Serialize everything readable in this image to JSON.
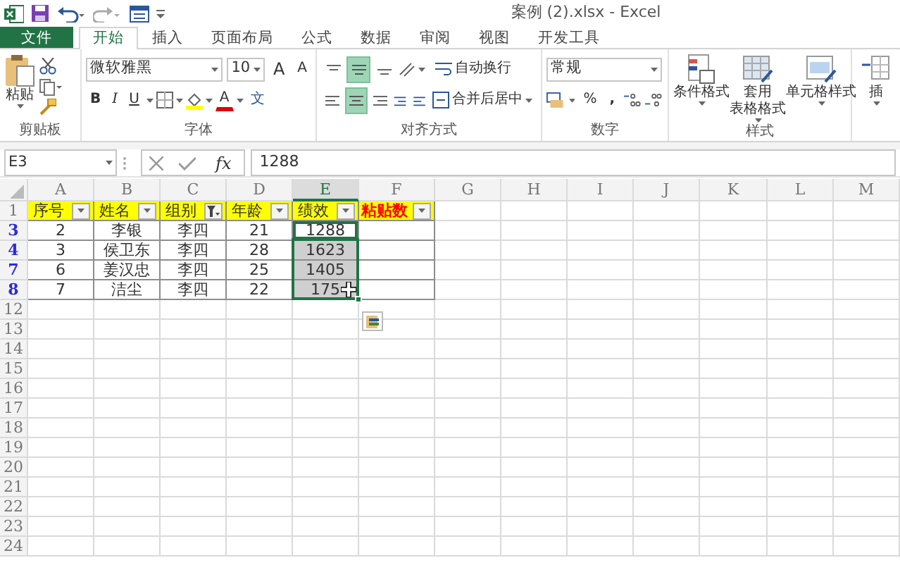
{
  "window": {
    "title": "案例 (2).xlsx - Excel"
  },
  "ribbon_tabs": [
    {
      "label": "文件",
      "kind": "file",
      "selected": false
    },
    {
      "label": "开始",
      "kind": "tab",
      "selected": true
    },
    {
      "label": "插入",
      "kind": "tab",
      "selected": false
    },
    {
      "label": "页面布局",
      "kind": "tab",
      "selected": false
    },
    {
      "label": "公式",
      "kind": "tab",
      "selected": false
    },
    {
      "label": "数据",
      "kind": "tab",
      "selected": false
    },
    {
      "label": "审阅",
      "kind": "tab",
      "selected": false
    },
    {
      "label": "视图",
      "kind": "tab",
      "selected": false
    },
    {
      "label": "开发工具",
      "kind": "tab",
      "selected": false
    }
  ],
  "ribbon": {
    "clipboard": {
      "label": "剪贴板",
      "paste": "粘贴"
    },
    "font": {
      "label": "字体",
      "font_name": "微软雅黑",
      "font_size": "10",
      "grow": "A",
      "shrink": "A",
      "bold": "B",
      "italic": "I",
      "underline": "U",
      "font_color": "A",
      "phonetic": "文"
    },
    "alignment": {
      "label": "对齐方式",
      "vertical": [
        {
          "selected": false
        },
        {
          "selected": true
        },
        {
          "selected": false
        }
      ],
      "horizontal": [
        {
          "selected": false
        },
        {
          "selected": true
        },
        {
          "selected": false
        }
      ],
      "wrap_text": "自动换行",
      "merge_center": "合并后居中"
    },
    "number": {
      "label": "数字",
      "format": "常规",
      "percent": "%",
      "comma": ","
    },
    "styles": {
      "label": "样式",
      "buttons": [
        {
          "lines": [
            "条件格式"
          ]
        },
        {
          "lines": [
            "套用",
            "表格格式"
          ]
        },
        {
          "lines": [
            "单元格样式"
          ]
        }
      ]
    },
    "cells": {
      "insert": "插"
    }
  },
  "formula_bar": {
    "name_box": "E3",
    "fx": "fx",
    "value": "1288"
  },
  "sheet": {
    "columns": [
      {
        "label": "A",
        "selected": false
      },
      {
        "label": "B",
        "selected": false
      },
      {
        "label": "C",
        "selected": false
      },
      {
        "label": "D",
        "selected": false
      },
      {
        "label": "E",
        "selected": true
      },
      {
        "label": "F",
        "selected": false
      },
      {
        "label": "G",
        "selected": false
      },
      {
        "label": "H",
        "selected": false
      },
      {
        "label": "I",
        "selected": false
      },
      {
        "label": "J",
        "selected": false
      },
      {
        "label": "K",
        "selected": false
      },
      {
        "label": "L",
        "selected": false
      },
      {
        "label": "M",
        "selected": false
      }
    ],
    "header_row": {
      "number": "1",
      "cells": [
        {
          "text": "序号",
          "filter_applied": false,
          "emphasis": false
        },
        {
          "text": "姓名",
          "filter_applied": false,
          "emphasis": false
        },
        {
          "text": "组别",
          "filter_applied": true,
          "emphasis": false
        },
        {
          "text": "年龄",
          "filter_applied": false,
          "emphasis": false
        },
        {
          "text": "绩效",
          "filter_applied": false,
          "emphasis": false
        },
        {
          "text": "粘贴数",
          "filter_applied": false,
          "emphasis": true
        }
      ]
    },
    "data_rows": [
      {
        "number": "3",
        "filtered": true,
        "cells": [
          {
            "text": "2",
            "selected": false,
            "active": false
          },
          {
            "text": "李银",
            "selected": false,
            "active": false
          },
          {
            "text": "李四",
            "selected": false,
            "active": false
          },
          {
            "text": "21",
            "selected": false,
            "active": false
          },
          {
            "text": "1288",
            "selected": false,
            "active": true
          }
        ]
      },
      {
        "number": "4",
        "filtered": true,
        "cells": [
          {
            "text": "3",
            "selected": false,
            "active": false
          },
          {
            "text": "侯卫东",
            "selected": false,
            "active": false
          },
          {
            "text": "李四",
            "selected": false,
            "active": false
          },
          {
            "text": "28",
            "selected": false,
            "active": false
          },
          {
            "text": "1623",
            "selected": true,
            "active": false
          }
        ]
      },
      {
        "number": "7",
        "filtered": true,
        "cells": [
          {
            "text": "6",
            "selected": false,
            "active": false
          },
          {
            "text": "姜汉忠",
            "selected": false,
            "active": false
          },
          {
            "text": "李四",
            "selected": false,
            "active": false
          },
          {
            "text": "25",
            "selected": false,
            "active": false
          },
          {
            "text": "1405",
            "selected": true,
            "active": false
          }
        ]
      },
      {
        "number": "8",
        "filtered": true,
        "cells": [
          {
            "text": "7",
            "selected": false,
            "active": false
          },
          {
            "text": "洁尘",
            "selected": false,
            "active": false
          },
          {
            "text": "李四",
            "selected": false,
            "active": false
          },
          {
            "text": "22",
            "selected": false,
            "active": false
          },
          {
            "text": "175",
            "selected": true,
            "active": false
          }
        ]
      }
    ],
    "empty_rows": [
      "12",
      "13",
      "14",
      "15",
      "16",
      "17",
      "18",
      "19",
      "20",
      "21",
      "22",
      "23",
      "24"
    ]
  }
}
